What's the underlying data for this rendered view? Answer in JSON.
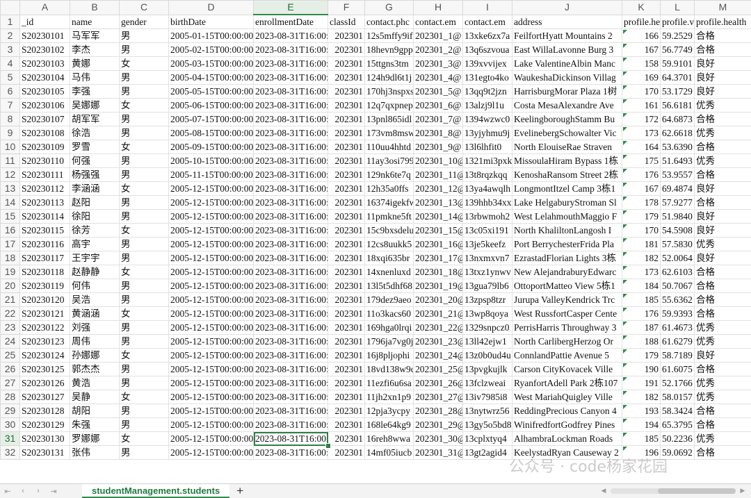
{
  "columns": [
    "A",
    "B",
    "C",
    "D",
    "E",
    "F",
    "G",
    "H",
    "I",
    "J",
    "K",
    "L",
    "M"
  ],
  "selected_column": "E",
  "selected_row": "31",
  "header_row": {
    "row_num": "1",
    "cells": [
      "_id",
      "name",
      "gender",
      "birthDate",
      "enrollmentDate",
      "classId",
      "contact.phc",
      "contact.em",
      "contact.em",
      "address",
      "profile.he",
      "profile.v",
      "profile.health"
    ]
  },
  "rows": [
    {
      "n": "2",
      "id": "S20230101",
      "name": "马军军",
      "gender": "男",
      "birth": "2005-01-15T00:00:00.",
      "enroll": "2023-08-31T16:00:",
      "cls": "202301",
      "phone": "12s5mffy9if",
      "email": "202301_1@",
      "email2": "13xke6zx7a",
      "addr": "FeilfortHyatt Mountains 2",
      "h": "166",
      "w": "59.2529",
      "health": "合格"
    },
    {
      "n": "3",
      "id": "S20230102",
      "name": "李杰",
      "gender": "男",
      "birth": "2005-02-15T00:00:00.",
      "enroll": "2023-08-31T16:00:",
      "cls": "202301",
      "phone": "18hevn9gpp",
      "email": "202301_2@",
      "email2": "13q6szvoua",
      "addr": "East WillaLavonne Burg 3",
      "h": "167",
      "w": "56.7749",
      "health": "合格"
    },
    {
      "n": "4",
      "id": "S20230103",
      "name": "黄娜",
      "gender": "女",
      "birth": "2005-03-15T00:00:00.",
      "enroll": "2023-08-31T16:00:",
      "cls": "202301",
      "phone": "15ttgns3tm",
      "email": "202301_3@",
      "email2": "139xvvijex",
      "addr": "Lake ValentineAlbin Manc",
      "h": "158",
      "w": "59.9101",
      "health": "良好"
    },
    {
      "n": "5",
      "id": "S20230104",
      "name": "马伟",
      "gender": "男",
      "birth": "2005-04-15T00:00:00.",
      "enroll": "2023-08-31T16:00:",
      "cls": "202301",
      "phone": "124h9dl6t1j",
      "email": "202301_4@",
      "email2": "131egto4ko",
      "addr": "WaukeshaDickinson Villag",
      "h": "169",
      "w": "64.3701",
      "health": "良好"
    },
    {
      "n": "6",
      "id": "S20230105",
      "name": "李强",
      "gender": "男",
      "birth": "2005-05-15T00:00:00.",
      "enroll": "2023-08-31T16:00:",
      "cls": "202301",
      "phone": "170hj3nspxs",
      "email": "202301_5@",
      "email2": "13qq9t2jzn",
      "addr": "HarrisburgMorar Plaza 1树",
      "h": "170",
      "w": "53.1729",
      "health": "良好"
    },
    {
      "n": "7",
      "id": "S20230106",
      "name": "吴娜娜",
      "gender": "女",
      "birth": "2005-06-15T00:00:00.",
      "enroll": "2023-08-31T16:00:",
      "cls": "202301",
      "phone": "12q7qxpnep",
      "email": "202301_6@",
      "email2": "13alzj9l1u",
      "addr": "Costa MesaAlexandre Ave",
      "h": "161",
      "w": "56.6181",
      "health": "优秀"
    },
    {
      "n": "8",
      "id": "S20230107",
      "name": "胡军军",
      "gender": "男",
      "birth": "2005-07-15T00:00:00.",
      "enroll": "2023-08-31T16:00:",
      "cls": "202301",
      "phone": "13pnl865idl",
      "email": "202301_7@",
      "email2": "1394wzwc0",
      "addr": "KeelingboroughStamm Bu",
      "h": "172",
      "w": "64.6873",
      "health": "合格"
    },
    {
      "n": "9",
      "id": "S20230108",
      "name": "徐浩",
      "gender": "男",
      "birth": "2005-08-15T00:00:00.",
      "enroll": "2023-08-31T16:00:",
      "cls": "202301",
      "phone": "173vm8msw",
      "email": "202301_8@",
      "email2": "13yjyhmu9j",
      "addr": "EvelinebergSchowalter Vic",
      "h": "173",
      "w": "62.6618",
      "health": "优秀"
    },
    {
      "n": "10",
      "id": "S20230109",
      "name": "罗雪",
      "gender": "女",
      "birth": "2005-09-15T00:00:00.",
      "enroll": "2023-08-31T16:00:",
      "cls": "202301",
      "phone": "110uu4hhtd",
      "email": "202301_9@",
      "email2": "13l6lhfit0",
      "addr": "North ElouiseRae Straven",
      "h": "164",
      "w": "53.6390",
      "health": "合格"
    },
    {
      "n": "11",
      "id": "S20230110",
      "name": "何强",
      "gender": "男",
      "birth": "2005-10-15T00:00:00.",
      "enroll": "2023-08-31T16:00:",
      "cls": "202301",
      "phone": "11ay3osi799",
      "email": "202301_10@",
      "email2": "1321mi3pxk",
      "addr": "MissoulaHiram Bypass 1栋",
      "h": "175",
      "w": "51.6493",
      "health": "优秀"
    },
    {
      "n": "12",
      "id": "S20230111",
      "name": "杨强强",
      "gender": "男",
      "birth": "2005-11-15T00:00:00.",
      "enroll": "2023-08-31T16:00:",
      "cls": "202301",
      "phone": "129nk6te7q",
      "email": "202301_11@",
      "email2": "13t8rqzkqq",
      "addr": "KenoshaRansom Street 2栋",
      "h": "176",
      "w": "53.9557",
      "health": "合格"
    },
    {
      "n": "13",
      "id": "S20230112",
      "name": "李涵涵",
      "gender": "女",
      "birth": "2005-12-15T00:00:00.",
      "enroll": "2023-08-31T16:00:",
      "cls": "202301",
      "phone": "12h35a0ffs",
      "email": "202301_12@",
      "email2": "13ya4awqlh",
      "addr": "LongmontItzel Camp 3栋1",
      "h": "167",
      "w": "69.4874",
      "health": "良好"
    },
    {
      "n": "14",
      "id": "S20230113",
      "name": "赵阳",
      "gender": "男",
      "birth": "2005-12-15T00:00:00.",
      "enroll": "2023-08-31T16:00:",
      "cls": "202301",
      "phone": "16374igekfw",
      "email": "202301_13@",
      "email2": "139hhb34xx",
      "addr": "Lake HelgaburyStroman Sl",
      "h": "178",
      "w": "57.9277",
      "health": "合格"
    },
    {
      "n": "15",
      "id": "S20230114",
      "name": "徐阳",
      "gender": "男",
      "birth": "2005-12-15T00:00:00.",
      "enroll": "2023-08-31T16:00:",
      "cls": "202301",
      "phone": "11pmkne5ft",
      "email": "202301_14@",
      "email2": "13rbwmoh2",
      "addr": "West LelahmouthMaggio F",
      "h": "179",
      "w": "51.9840",
      "health": "良好"
    },
    {
      "n": "16",
      "id": "S20230115",
      "name": "徐芳",
      "gender": "女",
      "birth": "2005-12-15T00:00:00.",
      "enroll": "2023-08-31T16:00:",
      "cls": "202301",
      "phone": "15c9bxsdelu",
      "email": "202301_15@",
      "email2": "13c05xi191",
      "addr": "North KhaliltonLangosh I",
      "h": "170",
      "w": "54.5908",
      "health": "良好"
    },
    {
      "n": "17",
      "id": "S20230116",
      "name": "高宇",
      "gender": "男",
      "birth": "2005-12-15T00:00:00.",
      "enroll": "2023-08-31T16:00:",
      "cls": "202301",
      "phone": "12cs8uukk5",
      "email": "202301_16@",
      "email2": "13je5keefz",
      "addr": "Port BerrychesterFrida Pla",
      "h": "181",
      "w": "57.5830",
      "health": "优秀"
    },
    {
      "n": "18",
      "id": "S20230117",
      "name": "王宇宇",
      "gender": "男",
      "birth": "2005-12-15T00:00:00.",
      "enroll": "2023-08-31T16:00:",
      "cls": "202301",
      "phone": "18xqi635br",
      "email": "202301_17@",
      "email2": "13nxmxvn7",
      "addr": "EzrastadFlorian Lights 3栋",
      "h": "182",
      "w": "52.0064",
      "health": "良好"
    },
    {
      "n": "19",
      "id": "S20230118",
      "name": "赵静静",
      "gender": "女",
      "birth": "2005-12-15T00:00:00.",
      "enroll": "2023-08-31T16:00:",
      "cls": "202301",
      "phone": "14xnenluxd",
      "email": "202301_18@",
      "email2": "13txz1ynwv",
      "addr": "New AlejandraburyEdwarc",
      "h": "173",
      "w": "62.6103",
      "health": "合格"
    },
    {
      "n": "20",
      "id": "S20230119",
      "name": "何伟",
      "gender": "男",
      "birth": "2005-12-15T00:00:00.",
      "enroll": "2023-08-31T16:00:",
      "cls": "202301",
      "phone": "13l5t5dhf68",
      "email": "202301_19@",
      "email2": "13gua79lb6",
      "addr": "OttoportMatteo View 5栋1",
      "h": "184",
      "w": "50.7067",
      "health": "合格"
    },
    {
      "n": "21",
      "id": "S20230120",
      "name": "吴浩",
      "gender": "男",
      "birth": "2005-12-15T00:00:00.",
      "enroll": "2023-08-31T16:00:",
      "cls": "202301",
      "phone": "179dez9aeo",
      "email": "202301_20@",
      "email2": "13zpsp8tzr",
      "addr": "Jurupa ValleyKendrick Trc",
      "h": "185",
      "w": "55.6362",
      "health": "合格"
    },
    {
      "n": "22",
      "id": "S20230121",
      "name": "黄涵涵",
      "gender": "女",
      "birth": "2005-12-15T00:00:00.",
      "enroll": "2023-08-31T16:00:",
      "cls": "202301",
      "phone": "11o3kacs60",
      "email": "202301_21@",
      "email2": "13wp8qoya",
      "addr": "West RussfortCasper Cente",
      "h": "176",
      "w": "59.9393",
      "health": "合格"
    },
    {
      "n": "23",
      "id": "S20230122",
      "name": "刘强",
      "gender": "男",
      "birth": "2005-12-15T00:00:00.",
      "enroll": "2023-08-31T16:00:",
      "cls": "202301",
      "phone": "169hga0lrqi",
      "email": "202301_22@",
      "email2": "1329snpcz0",
      "addr": "PerrisHarris Throughway 3",
      "h": "187",
      "w": "61.4673",
      "health": "优秀"
    },
    {
      "n": "24",
      "id": "S20230123",
      "name": "周伟",
      "gender": "男",
      "birth": "2005-12-15T00:00:00.",
      "enroll": "2023-08-31T16:00:",
      "cls": "202301",
      "phone": "1796ja7vg0j",
      "email": "202301_23@",
      "email2": "13ll42ejw1",
      "addr": "North CarlibergHerzog Or",
      "h": "188",
      "w": "61.6279",
      "health": "优秀"
    },
    {
      "n": "25",
      "id": "S20230124",
      "name": "孙娜娜",
      "gender": "女",
      "birth": "2005-12-15T00:00:00.",
      "enroll": "2023-08-31T16:00:",
      "cls": "202301",
      "phone": "16j8pljophi",
      "email": "202301_24@",
      "email2": "13z0b0ud4u",
      "addr": "ConnlandPattie Avenue 5",
      "h": "179",
      "w": "58.7189",
      "health": "良好"
    },
    {
      "n": "26",
      "id": "S20230125",
      "name": "郭杰杰",
      "gender": "男",
      "birth": "2005-12-15T00:00:00.",
      "enroll": "2023-08-31T16:00:",
      "cls": "202301",
      "phone": "18vd138w9c",
      "email": "202301_25@",
      "email2": "13pvgkujlk",
      "addr": "Carson CityKovacek Ville",
      "h": "190",
      "w": "61.6075",
      "health": "合格"
    },
    {
      "n": "27",
      "id": "S20230126",
      "name": "黄浩",
      "gender": "男",
      "birth": "2005-12-15T00:00:00.",
      "enroll": "2023-08-31T16:00:",
      "cls": "202301",
      "phone": "11ezfi6u6sa",
      "email": "202301_26@",
      "email2": "13fclzweai",
      "addr": "RyanfortAdell Park 2栋107",
      "h": "191",
      "w": "52.1766",
      "health": "优秀"
    },
    {
      "n": "28",
      "id": "S20230127",
      "name": "吴静",
      "gender": "女",
      "birth": "2005-12-15T00:00:00.",
      "enroll": "2023-08-31T16:00:",
      "cls": "202301",
      "phone": "11jh2xn1p9",
      "email": "202301_27@",
      "email2": "13iv7985i8",
      "addr": "West MariahQuigley Ville",
      "h": "182",
      "w": "58.0157",
      "health": "优秀"
    },
    {
      "n": "29",
      "id": "S20230128",
      "name": "胡阳",
      "gender": "男",
      "birth": "2005-12-15T00:00:00.",
      "enroll": "2023-08-31T16:00:",
      "cls": "202301",
      "phone": "12pja3ycpy",
      "email": "202301_28@",
      "email2": "13nytwrz56",
      "addr": "ReddingPrecious Canyon 4",
      "h": "193",
      "w": "58.3424",
      "health": "合格"
    },
    {
      "n": "30",
      "id": "S20230129",
      "name": "朱强",
      "gender": "男",
      "birth": "2005-12-15T00:00:00.",
      "enroll": "2023-08-31T16:00:",
      "cls": "202301",
      "phone": "168le64kg9",
      "email": "202301_29@",
      "email2": "13gy5o5bd8",
      "addr": "WinifredfortGodfrey Pines",
      "h": "194",
      "w": "65.3795",
      "health": "合格"
    },
    {
      "n": "31",
      "id": "S20230130",
      "name": "罗娜娜",
      "gender": "女",
      "birth": "2005-12-15T00:00:00.",
      "enroll": "2023-08-31T16:00:",
      "cls": "202301",
      "phone": "16reh8wwa",
      "email": "202301_30@",
      "email2": "13cplxtyq4",
      "addr": "AlhambraLockman Roads",
      "h": "185",
      "w": "50.2236",
      "health": "优秀"
    },
    {
      "n": "32",
      "id": "S20230131",
      "name": "张伟",
      "gender": "男",
      "birth": "2005-12-15T00:00:00.",
      "enroll": "2023-08-31T16:00:",
      "cls": "202301",
      "phone": "14mf05iucb",
      "email": "202301_31@",
      "email2": "13gt2agid4",
      "addr": "KeelystadRyan Causeway 2",
      "h": "196",
      "w": "59.0692",
      "health": "合格"
    }
  ],
  "bottom_bar": {
    "nav_first": "⇤",
    "nav_prev": "‹",
    "nav_next": "›",
    "nav_last": "⇥",
    "sheet_tab": "studentManagement.students",
    "add_sheet": "+"
  },
  "watermark": "公众号 · code杨家花园",
  "accent_color": "#2f8a4b"
}
